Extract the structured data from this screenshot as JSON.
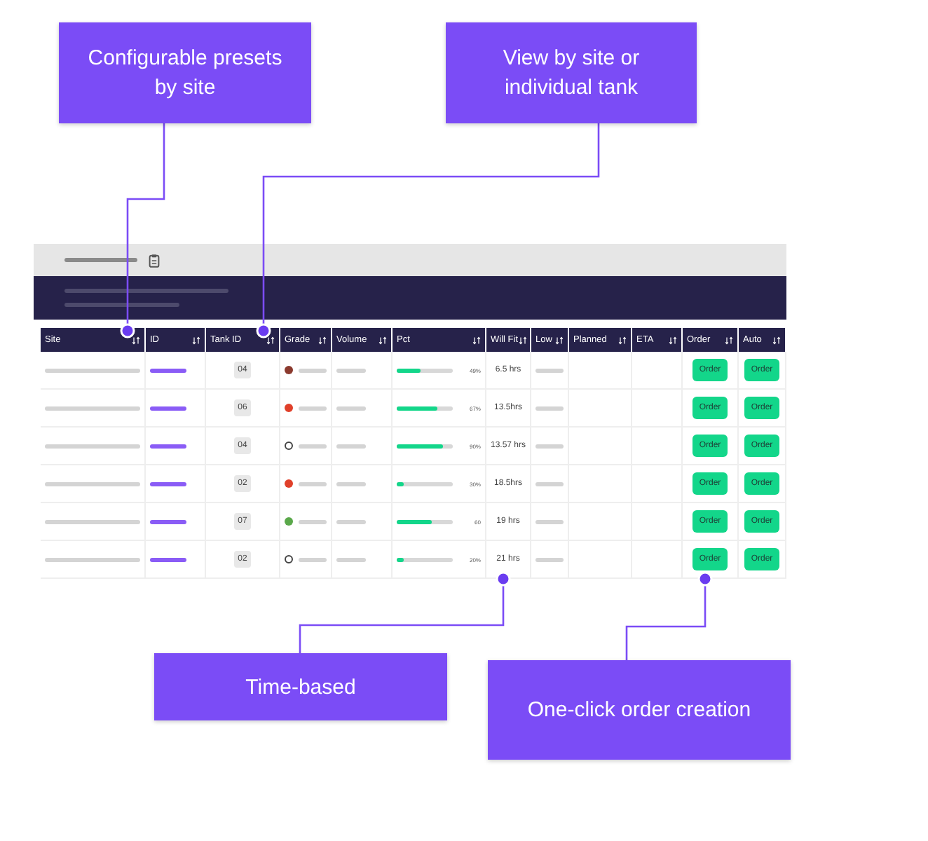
{
  "callouts": [
    {
      "text": "Configurable presets by site"
    },
    {
      "text": "View by site or individual tank"
    },
    {
      "text": "Time-based"
    },
    {
      "text": "One-click order creation"
    }
  ],
  "table": {
    "columns": [
      "Site",
      "ID",
      "Tank ID",
      "Grade",
      "Volume",
      "Pct",
      "Will Fit",
      "Low",
      "Planned",
      "ETA",
      "Order",
      "Auto"
    ],
    "rows": [
      {
        "tank_id": "04",
        "color": "#8b3a2e",
        "level": 0.42,
        "pct": "49%",
        "will_fit": "6.5 hrs",
        "order": "Order",
        "auto": "Order"
      },
      {
        "tank_id": "06",
        "color": "#e0402a",
        "level": 0.72,
        "pct": "67%",
        "will_fit": "13.5hrs",
        "order": "Order",
        "auto": "Order"
      },
      {
        "tank_id": "04",
        "color": "#ffffff",
        "level": 0.82,
        "pct": "90%",
        "will_fit": "13.57 hrs",
        "order": "Order",
        "auto": "Order"
      },
      {
        "tank_id": "02",
        "color": "#e0402a",
        "level": 0.12,
        "pct": "30%",
        "will_fit": "18.5hrs",
        "order": "Order",
        "auto": "Order"
      },
      {
        "tank_id": "07",
        "color": "#5aa84a",
        "level": 0.62,
        "pct": "60",
        "will_fit": "19 hrs",
        "order": "Order",
        "auto": "Order"
      },
      {
        "tank_id": "02",
        "color": "#ffffff",
        "level": 0.12,
        "pct": "20%",
        "will_fit": "21 hrs",
        "order": "Order",
        "auto": "Order"
      }
    ]
  }
}
